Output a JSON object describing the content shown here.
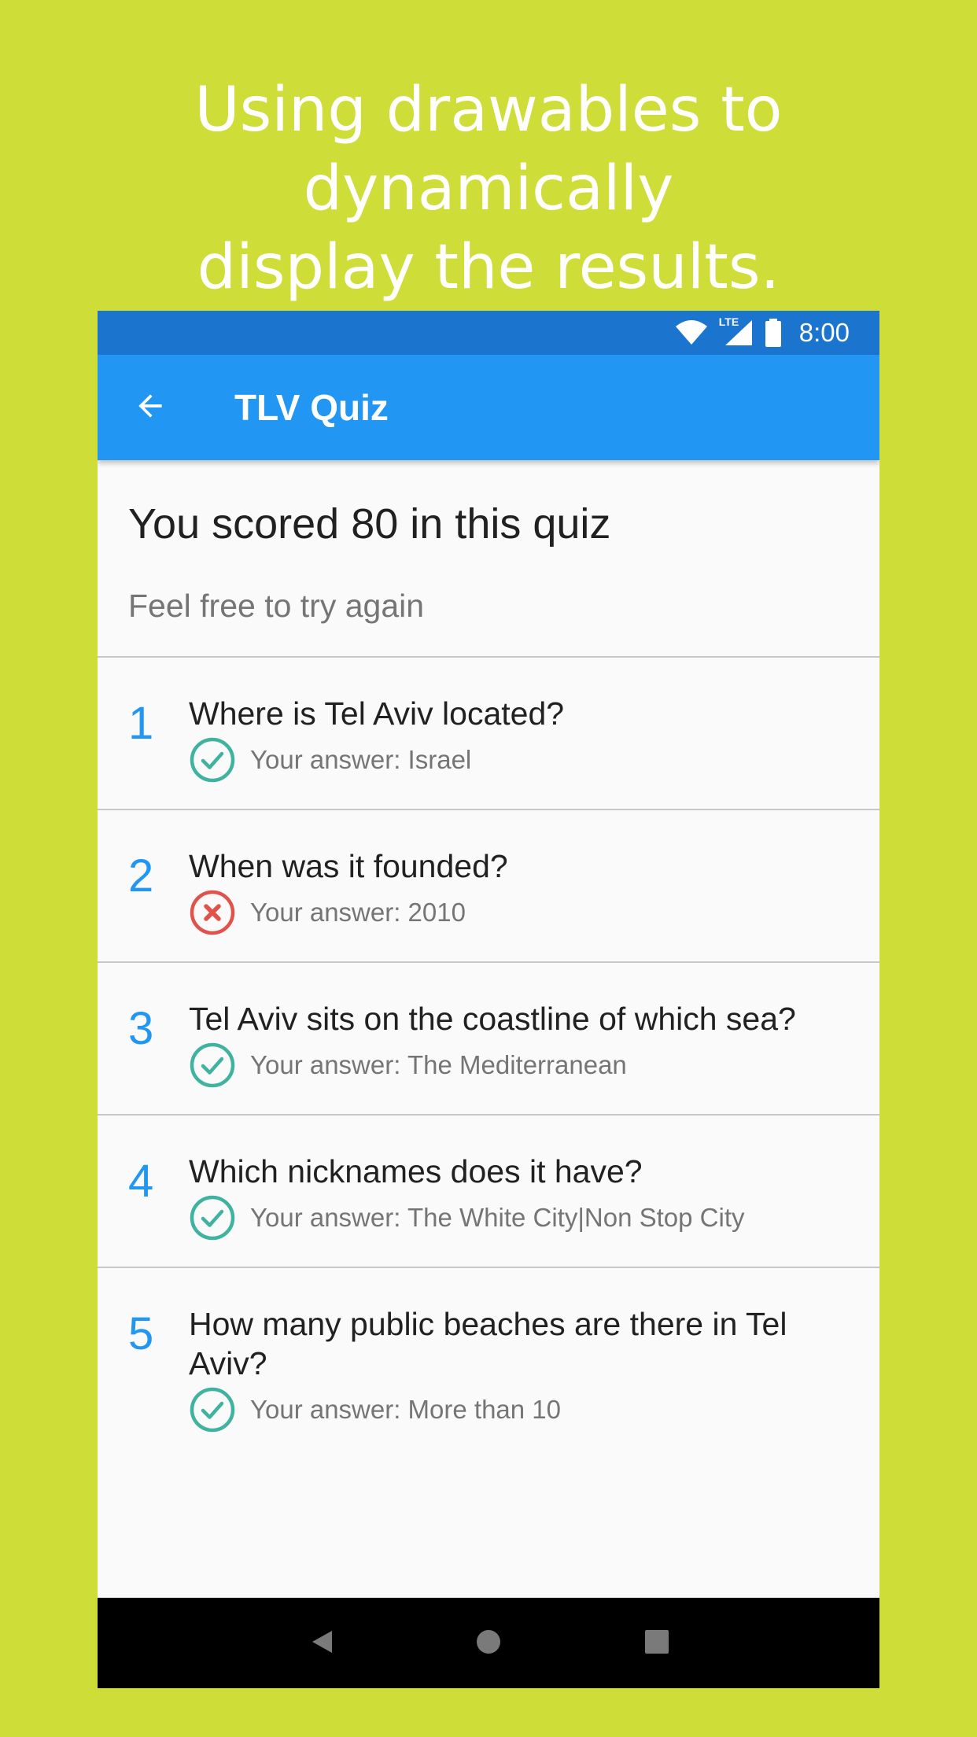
{
  "promo": {
    "caption": "Using drawables to dynamically\ndisplay the results."
  },
  "status_bar": {
    "time": "8:00",
    "network_label": "LTE",
    "icons": [
      "wifi-icon",
      "lte-signal-icon",
      "battery-icon"
    ]
  },
  "app_bar": {
    "title": "TLV Quiz",
    "back_icon": "arrow-back-icon"
  },
  "score": {
    "title": "You scored 80 in this quiz",
    "subtitle": "Feel free to try again"
  },
  "results": [
    {
      "number": "1",
      "question": "Where is Tel Aviv located?",
      "answer": "Your answer: Israel",
      "correct": true
    },
    {
      "number": "2",
      "question": "When was it founded?",
      "answer": "Your answer: 2010",
      "correct": false
    },
    {
      "number": "3",
      "question": "Tel Aviv sits on the coastline of which sea?",
      "answer": "Your answer: The Mediterranean",
      "correct": true
    },
    {
      "number": "4",
      "question": "Which nicknames does it have?",
      "answer": "Your answer: The White City|Non Stop City",
      "correct": true
    },
    {
      "number": "5",
      "question": "How many public beaches are there in Tel Aviv?",
      "answer": "Your answer: More than 10",
      "correct": true
    }
  ],
  "colors": {
    "background": "#cfdd38",
    "status_bar": "#1b75cf",
    "app_bar": "#2196f3",
    "accent_number": "#2196f3",
    "correct": "#3fb39f",
    "incorrect": "#e0534a"
  },
  "nav_bar": {
    "icons": [
      "back-triangle-icon",
      "home-circle-icon",
      "recents-square-icon"
    ]
  }
}
